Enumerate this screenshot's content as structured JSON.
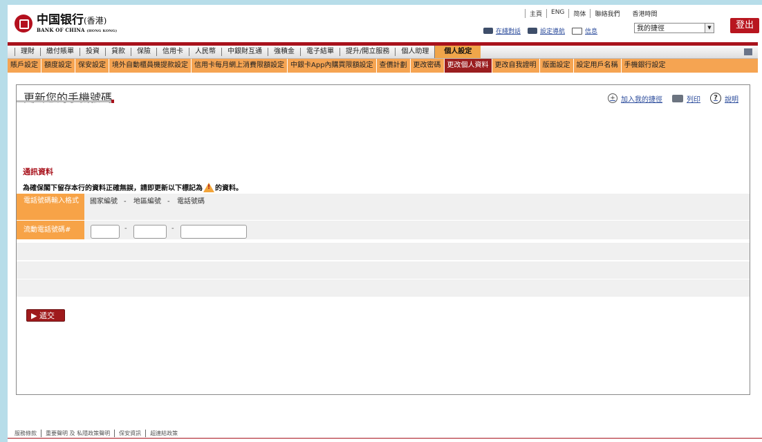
{
  "header": {
    "logo_cn": "中国银行",
    "logo_cn_suffix": "(香港)",
    "logo_en": "BANK OF CHINA",
    "logo_en_suffix": "(HONG KONG)",
    "top_links": [
      "主頁",
      "ENG",
      "简体",
      "聯絡我們",
      "香港時間"
    ],
    "online_chat": "在綫對話",
    "settings_guide": "設定導航",
    "messages": "信息",
    "quick_link_value": "我的捷徑",
    "logout": "登出"
  },
  "nav_primary": {
    "items": [
      "理財",
      "繳付賬單",
      "投資",
      "貸款",
      "保險",
      "信用卡",
      "人民幣",
      "中銀財互通",
      "強積金",
      "電子結單",
      "提升/開立服務",
      "個人助理",
      "個人設定"
    ],
    "active": "個人設定"
  },
  "nav_secondary": {
    "items": [
      "賬戶設定",
      "額度設定",
      "保安設定",
      "境外自動櫃員機提款設定",
      "信用卡每月網上消費限額設定",
      "中銀卡App內購買限額設定",
      "查價計劃",
      "更改密碼",
      "更改個人資料",
      "更改自我證明",
      "版面設定",
      "設定用戶名稱",
      "手機銀行設定"
    ],
    "active": "更改個人資料"
  },
  "page": {
    "title": "更新您的手機號碼",
    "add_favourite": "加入我的捷徑",
    "print": "列印",
    "help": "說明",
    "section_heading": "通訊資料",
    "instruction_before": "為確保閣下留存本行的資料正確無誤，請即更新以下標記為",
    "instruction_after": "的資料。",
    "format_label": "電話號碼輸入格式",
    "country_code": "國家編號",
    "area_code": "地區編號",
    "phone_number": "電話號碼",
    "mobile_label": "流動電話號碼#",
    "submit": "遞交"
  },
  "footer": {
    "links": [
      "服務條款",
      "重要聲明 及 私隱政策聲明",
      "保安資訊",
      "超連結政策"
    ]
  }
}
